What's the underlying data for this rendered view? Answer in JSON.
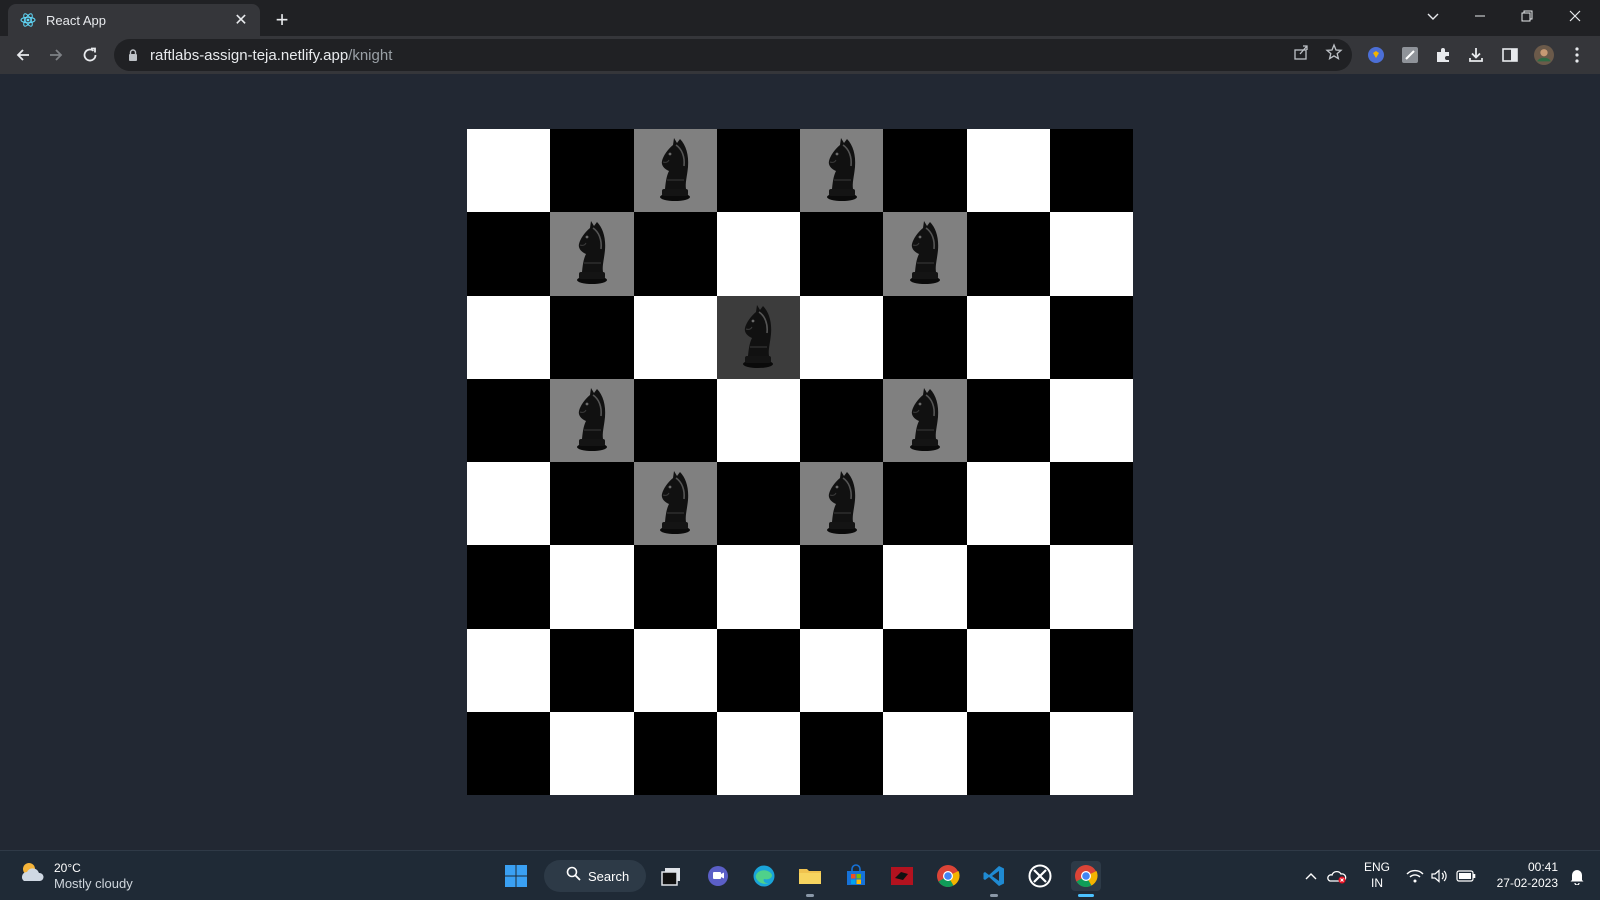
{
  "browser": {
    "tab_title": "React App",
    "url_host": "raftlabs-assign-teja.netlify.app",
    "url_path": "/knight"
  },
  "board": {
    "size": 8,
    "knight_position": {
      "row": 2,
      "col": 3
    },
    "possible_moves": [
      {
        "row": 0,
        "col": 2
      },
      {
        "row": 0,
        "col": 4
      },
      {
        "row": 1,
        "col": 1
      },
      {
        "row": 1,
        "col": 5
      },
      {
        "row": 3,
        "col": 1
      },
      {
        "row": 3,
        "col": 5
      },
      {
        "row": 4,
        "col": 2
      },
      {
        "row": 4,
        "col": 4
      }
    ],
    "colors": {
      "light": "#ffffff",
      "dark": "#000000",
      "move": "#808080",
      "current": "#3c3c3c"
    }
  },
  "taskbar": {
    "weather_temp": "20°C",
    "weather_desc": "Mostly cloudy",
    "search_label": "Search",
    "lang_primary": "ENG",
    "lang_secondary": "IN",
    "time": "00:41",
    "date": "27-02-2023"
  }
}
